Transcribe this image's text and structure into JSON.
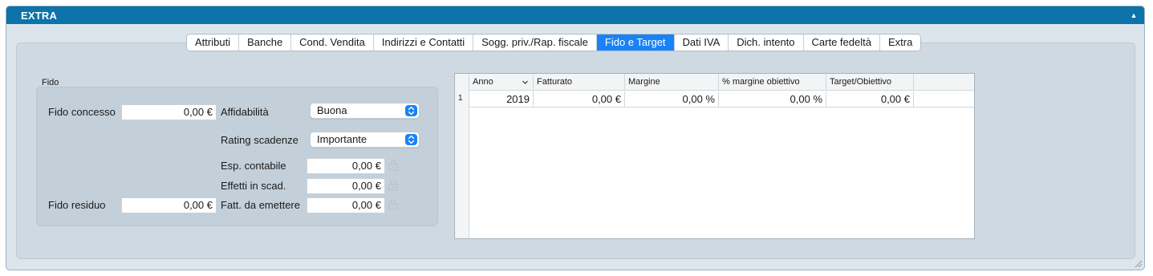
{
  "panel": {
    "title": "EXTRA"
  },
  "tabs": [
    {
      "label": "Attributi"
    },
    {
      "label": "Banche"
    },
    {
      "label": "Cond. Vendita"
    },
    {
      "label": "Indirizzi e Contatti"
    },
    {
      "label": "Sogg. priv./Rap. fiscale"
    },
    {
      "label": "Fido e Target",
      "active": true
    },
    {
      "label": "Dati IVA"
    },
    {
      "label": "Dich. intento"
    },
    {
      "label": "Carte fedeltà"
    },
    {
      "label": "Extra"
    }
  ],
  "fido": {
    "group_label": "Fido",
    "fido_concesso_label": "Fido concesso",
    "fido_concesso_value": "0,00 €",
    "fido_residuo_label": "Fido residuo",
    "fido_residuo_value": "0,00 €",
    "affidabilita_label": "Affidabilità",
    "affidabilita_value": "Buona",
    "rating_label": "Rating scadenze",
    "rating_value": "Importante",
    "esp_contabile_label": "Esp. contabile",
    "esp_contabile_value": "0,00 €",
    "effetti_label": "Effetti in scad.",
    "effetti_value": "0,00 €",
    "fatt_label": "Fatt. da emettere",
    "fatt_value": "0,00 €"
  },
  "target_table": {
    "columns": [
      "Anno",
      "Fatturato",
      "Margine",
      "% margine obiettivo",
      "Target/Obiettivo"
    ],
    "rows": [
      {
        "num": "1",
        "anno": "2019",
        "fatturato": "0,00 €",
        "margine": "0,00 %",
        "margine_obiettivo": "0,00 %",
        "target": "0,00 €"
      }
    ]
  }
}
